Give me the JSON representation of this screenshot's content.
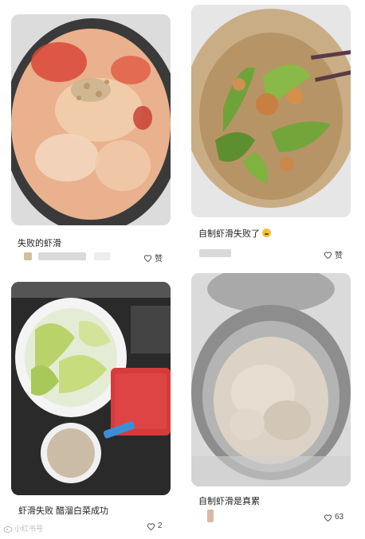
{
  "feed": {
    "cards": [
      {
        "title": "失败的虾滑",
        "like_label": "赞",
        "like_count": ""
      },
      {
        "title": "自制虾滑失败了",
        "like_label": "赞",
        "like_count": ""
      },
      {
        "title": "虾滑失败 醋溜白菜成功",
        "like_label": "",
        "like_count": "2"
      },
      {
        "title": "自制虾滑是真累",
        "like_label": "",
        "like_count": "63"
      }
    ]
  },
  "watermark": {
    "text": "小红书号"
  },
  "icons": {
    "heart": "heart-outline-icon",
    "emoji": "grin-emoji-icon",
    "watermark": "weibo-icon"
  },
  "colors": {
    "card_bg": "#f2f2f2",
    "blur": "#d9d9d9",
    "text": "#222222"
  }
}
